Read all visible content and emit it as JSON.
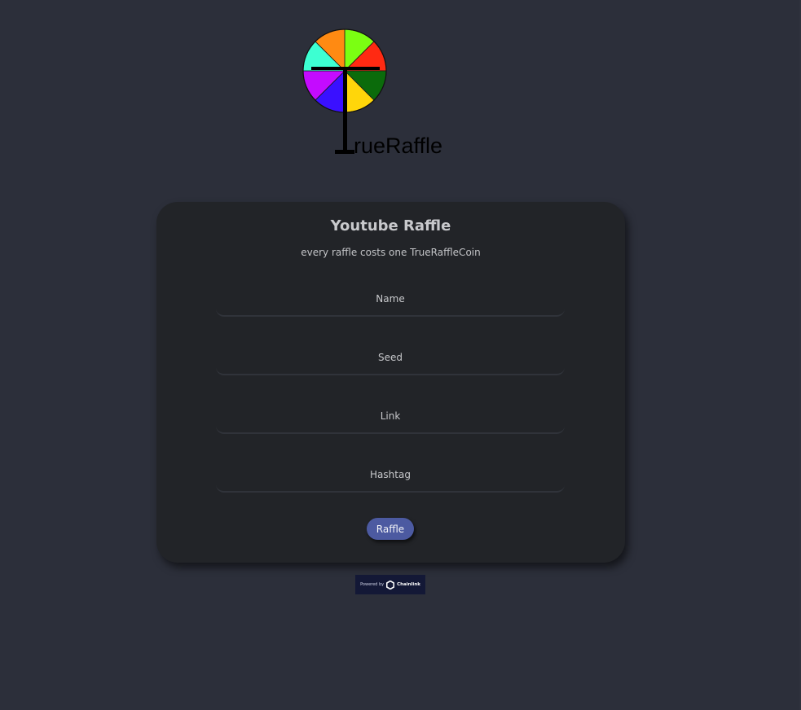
{
  "logo": {
    "text": "rueRaffle",
    "wheel_colors": [
      "#7bff12",
      "#ff2a12",
      "#0b6b0b",
      "#ffd60a",
      "#3a10ff",
      "#c40bff",
      "#3dffd2",
      "#ff8a12"
    ]
  },
  "card": {
    "title": "Youtube Raffle",
    "subtitle": "every raffle costs one TrueRaffleCoin"
  },
  "form": {
    "name_placeholder": "Name",
    "seed_placeholder": "Seed",
    "link_placeholder": "Link",
    "hashtag_placeholder": "Hashtag",
    "submit_label": "Raffle"
  },
  "badge": {
    "powered_by": "Powered by",
    "brand": "Chainlink"
  },
  "colors": {
    "background": "#2c2f3a",
    "card": "#222428",
    "button": "#4c5aa1"
  }
}
